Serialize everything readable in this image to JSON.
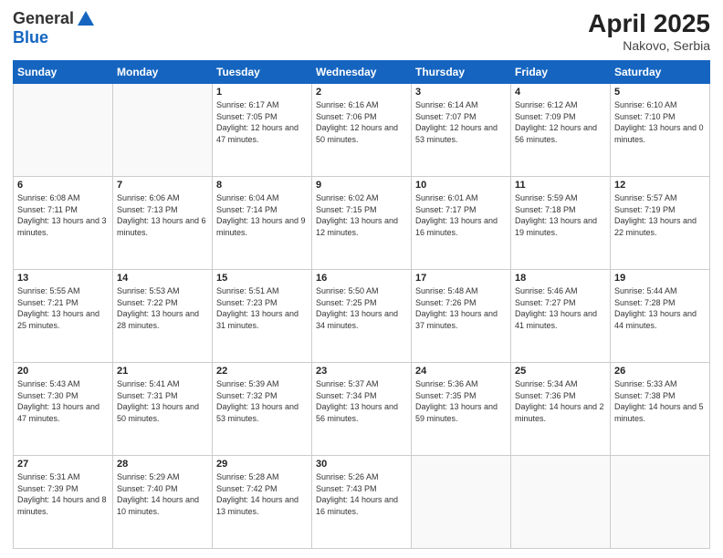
{
  "header": {
    "logo_general": "General",
    "logo_blue": "Blue",
    "title": "April 2025",
    "location": "Nakovo, Serbia"
  },
  "days_of_week": [
    "Sunday",
    "Monday",
    "Tuesday",
    "Wednesday",
    "Thursday",
    "Friday",
    "Saturday"
  ],
  "weeks": [
    [
      {
        "day": "",
        "info": ""
      },
      {
        "day": "",
        "info": ""
      },
      {
        "day": "1",
        "info": "Sunrise: 6:17 AM\nSunset: 7:05 PM\nDaylight: 12 hours and 47 minutes."
      },
      {
        "day": "2",
        "info": "Sunrise: 6:16 AM\nSunset: 7:06 PM\nDaylight: 12 hours and 50 minutes."
      },
      {
        "day": "3",
        "info": "Sunrise: 6:14 AM\nSunset: 7:07 PM\nDaylight: 12 hours and 53 minutes."
      },
      {
        "day": "4",
        "info": "Sunrise: 6:12 AM\nSunset: 7:09 PM\nDaylight: 12 hours and 56 minutes."
      },
      {
        "day": "5",
        "info": "Sunrise: 6:10 AM\nSunset: 7:10 PM\nDaylight: 13 hours and 0 minutes."
      }
    ],
    [
      {
        "day": "6",
        "info": "Sunrise: 6:08 AM\nSunset: 7:11 PM\nDaylight: 13 hours and 3 minutes."
      },
      {
        "day": "7",
        "info": "Sunrise: 6:06 AM\nSunset: 7:13 PM\nDaylight: 13 hours and 6 minutes."
      },
      {
        "day": "8",
        "info": "Sunrise: 6:04 AM\nSunset: 7:14 PM\nDaylight: 13 hours and 9 minutes."
      },
      {
        "day": "9",
        "info": "Sunrise: 6:02 AM\nSunset: 7:15 PM\nDaylight: 13 hours and 12 minutes."
      },
      {
        "day": "10",
        "info": "Sunrise: 6:01 AM\nSunset: 7:17 PM\nDaylight: 13 hours and 16 minutes."
      },
      {
        "day": "11",
        "info": "Sunrise: 5:59 AM\nSunset: 7:18 PM\nDaylight: 13 hours and 19 minutes."
      },
      {
        "day": "12",
        "info": "Sunrise: 5:57 AM\nSunset: 7:19 PM\nDaylight: 13 hours and 22 minutes."
      }
    ],
    [
      {
        "day": "13",
        "info": "Sunrise: 5:55 AM\nSunset: 7:21 PM\nDaylight: 13 hours and 25 minutes."
      },
      {
        "day": "14",
        "info": "Sunrise: 5:53 AM\nSunset: 7:22 PM\nDaylight: 13 hours and 28 minutes."
      },
      {
        "day": "15",
        "info": "Sunrise: 5:51 AM\nSunset: 7:23 PM\nDaylight: 13 hours and 31 minutes."
      },
      {
        "day": "16",
        "info": "Sunrise: 5:50 AM\nSunset: 7:25 PM\nDaylight: 13 hours and 34 minutes."
      },
      {
        "day": "17",
        "info": "Sunrise: 5:48 AM\nSunset: 7:26 PM\nDaylight: 13 hours and 37 minutes."
      },
      {
        "day": "18",
        "info": "Sunrise: 5:46 AM\nSunset: 7:27 PM\nDaylight: 13 hours and 41 minutes."
      },
      {
        "day": "19",
        "info": "Sunrise: 5:44 AM\nSunset: 7:28 PM\nDaylight: 13 hours and 44 minutes."
      }
    ],
    [
      {
        "day": "20",
        "info": "Sunrise: 5:43 AM\nSunset: 7:30 PM\nDaylight: 13 hours and 47 minutes."
      },
      {
        "day": "21",
        "info": "Sunrise: 5:41 AM\nSunset: 7:31 PM\nDaylight: 13 hours and 50 minutes."
      },
      {
        "day": "22",
        "info": "Sunrise: 5:39 AM\nSunset: 7:32 PM\nDaylight: 13 hours and 53 minutes."
      },
      {
        "day": "23",
        "info": "Sunrise: 5:37 AM\nSunset: 7:34 PM\nDaylight: 13 hours and 56 minutes."
      },
      {
        "day": "24",
        "info": "Sunrise: 5:36 AM\nSunset: 7:35 PM\nDaylight: 13 hours and 59 minutes."
      },
      {
        "day": "25",
        "info": "Sunrise: 5:34 AM\nSunset: 7:36 PM\nDaylight: 14 hours and 2 minutes."
      },
      {
        "day": "26",
        "info": "Sunrise: 5:33 AM\nSunset: 7:38 PM\nDaylight: 14 hours and 5 minutes."
      }
    ],
    [
      {
        "day": "27",
        "info": "Sunrise: 5:31 AM\nSunset: 7:39 PM\nDaylight: 14 hours and 8 minutes."
      },
      {
        "day": "28",
        "info": "Sunrise: 5:29 AM\nSunset: 7:40 PM\nDaylight: 14 hours and 10 minutes."
      },
      {
        "day": "29",
        "info": "Sunrise: 5:28 AM\nSunset: 7:42 PM\nDaylight: 14 hours and 13 minutes."
      },
      {
        "day": "30",
        "info": "Sunrise: 5:26 AM\nSunset: 7:43 PM\nDaylight: 14 hours and 16 minutes."
      },
      {
        "day": "",
        "info": ""
      },
      {
        "day": "",
        "info": ""
      },
      {
        "day": "",
        "info": ""
      }
    ]
  ]
}
